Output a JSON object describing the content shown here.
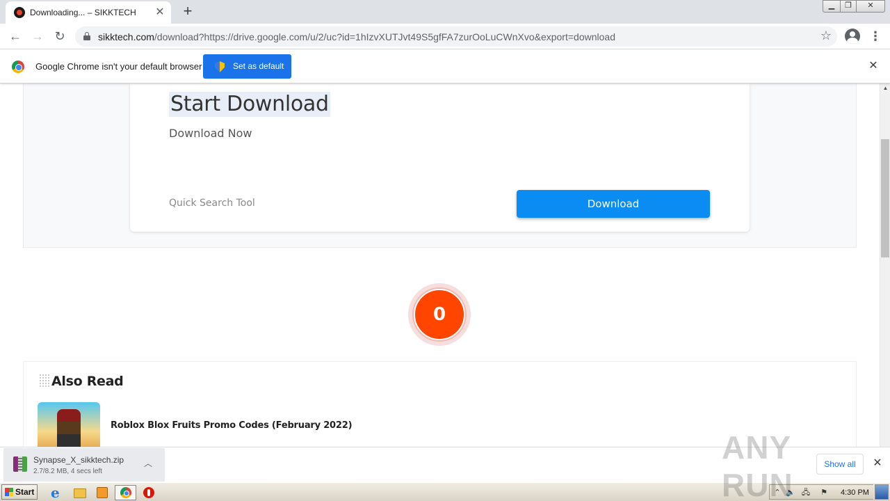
{
  "browser": {
    "tab_title": "Downloading... – SIKKTECH",
    "tab_close_glyph": "✕",
    "new_tab_glyph": "+",
    "url_host": "sikktech.com",
    "url_path": "/download?https://drive.google.com/u/2/uc?id=1hIzvXUTJvt49S5gfFA7zurOoLuCWnXvo&export=download"
  },
  "infobar": {
    "message": "Google Chrome isn't your default browser",
    "set_default_label": "Set as default"
  },
  "hero": {
    "title": "Start Download",
    "subtitle": "Download Now",
    "quick_search": "Quick Search Tool",
    "download_label": "Download"
  },
  "countdown": {
    "value": "0",
    "color": "#ff4500"
  },
  "also_read": {
    "heading": "Also Read",
    "articles": [
      {
        "title": "Roblox Blox Fruits Promo Codes (February 2022)"
      }
    ]
  },
  "download_shelf": {
    "file_name": "Synapse_X_sikktech.zip",
    "status": "2.7/8.2 MB, 4 secs left",
    "show_all_label": "Show all"
  },
  "watermark": {
    "text": "ANY RUN"
  },
  "taskbar": {
    "start_label": "Start",
    "clock": "4:30 PM"
  },
  "colors": {
    "chrome_blue": "#1a73e8",
    "download_button": "#0b8cf3",
    "countdown": "#ff4500"
  },
  "icons": {
    "back": "arrow-left",
    "forward": "arrow-right",
    "reload": "reload",
    "star": "star",
    "profile": "account-circle",
    "menu": "vertical-dots",
    "infobar_close": "close",
    "chevron": "chevron-up",
    "shelf_close": "close"
  }
}
